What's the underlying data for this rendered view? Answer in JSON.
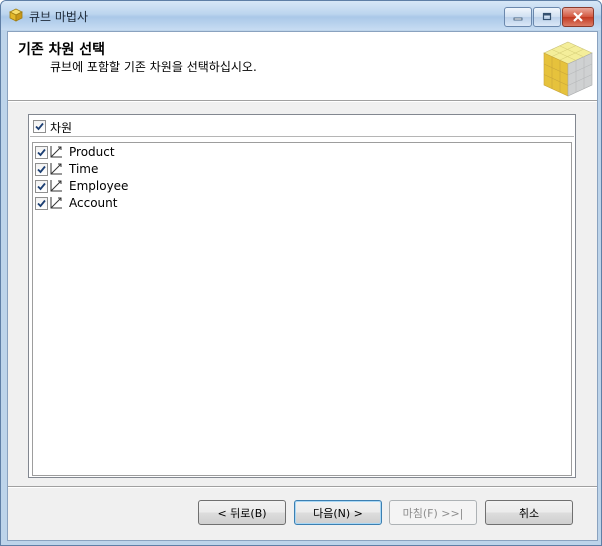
{
  "window": {
    "title": "큐브 마법사"
  },
  "header": {
    "title": "기존 차원 선택",
    "subtitle": "큐브에 포함할 기존 차원을 선택하십시오."
  },
  "list": {
    "header_label": "차원",
    "header_checked": true,
    "items": [
      {
        "label": "Product",
        "checked": true
      },
      {
        "label": "Time",
        "checked": true
      },
      {
        "label": "Employee",
        "checked": true
      },
      {
        "label": "Account",
        "checked": true
      }
    ]
  },
  "buttons": {
    "back": "< 뒤로(B)",
    "next": "다음(N) >",
    "finish": "마침(F) >>|",
    "cancel": "취소"
  },
  "icons": {
    "app": "cube-icon",
    "dimension": "dimension-icon",
    "header_graphic": "cube-graphic"
  }
}
